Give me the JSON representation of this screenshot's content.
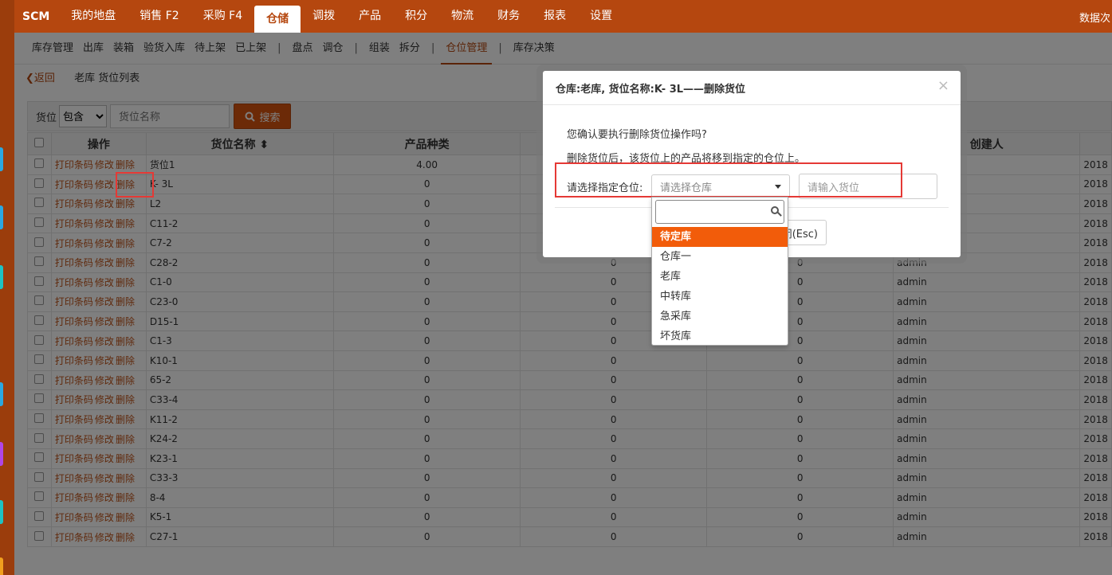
{
  "topnav": {
    "brand": "SCM",
    "items": [
      "我的地盘",
      "销售 F2",
      "采购 F4",
      "仓储",
      "调拨",
      "产品",
      "积分",
      "物流",
      "财务",
      "报表",
      "设置"
    ],
    "active_index": 3,
    "right_text": "数据次"
  },
  "subnav": {
    "items": [
      "库存管理",
      "出库",
      "装箱",
      "验货入库",
      "待上架",
      "已上架",
      "|",
      "盘点",
      "调仓",
      "|",
      "组装",
      "拆分",
      "|",
      "仓位管理",
      "|",
      "库存决策"
    ],
    "active": "仓位管理"
  },
  "crumb": {
    "back": "返回",
    "title": "老库 货位列表"
  },
  "toolbar": {
    "field_label": "货位",
    "match_select": "包含",
    "name_placeholder": "货位名称",
    "search_label": "搜索"
  },
  "table": {
    "headers": [
      "操作",
      "货位名称 ⬍",
      "产品种类",
      "",
      "",
      "创建人"
    ],
    "op_labels": [
      "打印条码",
      "修改",
      "删除"
    ],
    "rows": [
      {
        "name": "货位1",
        "kinds": "4.00",
        "c4": "",
        "c5": "",
        "creator": "",
        "date": "2018"
      },
      {
        "name": "K- 3L",
        "kinds": "0",
        "c4": "",
        "c5": "",
        "creator": "",
        "date": "2018"
      },
      {
        "name": "L2",
        "kinds": "0",
        "c4": "",
        "c5": "",
        "creator": "",
        "date": "2018"
      },
      {
        "name": "C11-2",
        "kinds": "0",
        "c4": "",
        "c5": "",
        "creator": "",
        "date": "2018"
      },
      {
        "name": "C7-2",
        "kinds": "0",
        "c4": "",
        "c5": "",
        "creator": "",
        "date": "2018"
      },
      {
        "name": "C28-2",
        "kinds": "0",
        "c4": "0",
        "c5": "0",
        "creator": "admin",
        "date": "2018"
      },
      {
        "name": "C1-0",
        "kinds": "0",
        "c4": "0",
        "c5": "0",
        "creator": "admin",
        "date": "2018"
      },
      {
        "name": "C23-0",
        "kinds": "0",
        "c4": "0",
        "c5": "0",
        "creator": "admin",
        "date": "2018"
      },
      {
        "name": "D15-1",
        "kinds": "0",
        "c4": "0",
        "c5": "0",
        "creator": "admin",
        "date": "2018"
      },
      {
        "name": "C1-3",
        "kinds": "0",
        "c4": "0",
        "c5": "0",
        "creator": "admin",
        "date": "2018"
      },
      {
        "name": "K10-1",
        "kinds": "0",
        "c4": "0",
        "c5": "0",
        "creator": "admin",
        "date": "2018"
      },
      {
        "name": "65-2",
        "kinds": "0",
        "c4": "0",
        "c5": "0",
        "creator": "admin",
        "date": "2018"
      },
      {
        "name": "C33-4",
        "kinds": "0",
        "c4": "0",
        "c5": "0",
        "creator": "admin",
        "date": "2018"
      },
      {
        "name": "K11-2",
        "kinds": "0",
        "c4": "0",
        "c5": "0",
        "creator": "admin",
        "date": "2018"
      },
      {
        "name": "K24-2",
        "kinds": "0",
        "c4": "0",
        "c5": "0",
        "creator": "admin",
        "date": "2018"
      },
      {
        "name": "K23-1",
        "kinds": "0",
        "c4": "0",
        "c5": "0",
        "creator": "admin",
        "date": "2018"
      },
      {
        "name": "C33-3",
        "kinds": "0",
        "c4": "0",
        "c5": "0",
        "creator": "admin",
        "date": "2018"
      },
      {
        "name": "8-4",
        "kinds": "0",
        "c4": "0",
        "c5": "0",
        "creator": "admin",
        "date": "2018"
      },
      {
        "name": "K5-1",
        "kinds": "0",
        "c4": "0",
        "c5": "0",
        "creator": "admin",
        "date": "2018"
      },
      {
        "name": "C27-1",
        "kinds": "0",
        "c4": "0",
        "c5": "0",
        "creator": "admin",
        "date": "2018"
      }
    ]
  },
  "modal": {
    "title": "仓库:老库, 货位名称:K- 3L——删除货位",
    "confirm_text": "您确认要执行删除货位操作吗?",
    "note_text": "删除货位后，该货位上的产品将移到指定的仓位上。",
    "pick_label": "请选择指定仓位:",
    "warehouse_placeholder": "请选择仓库",
    "slot_placeholder": "请输入货位",
    "close_button": "闭(Esc)"
  },
  "dropdown": {
    "options": [
      "待定库",
      "仓库一",
      "老库",
      "中转库",
      "急采库",
      "坏货库"
    ],
    "highlighted": 0
  },
  "colors": {
    "brand": "#b5470f",
    "accent": "#f25c0a",
    "highlight_box": "#e53935"
  }
}
